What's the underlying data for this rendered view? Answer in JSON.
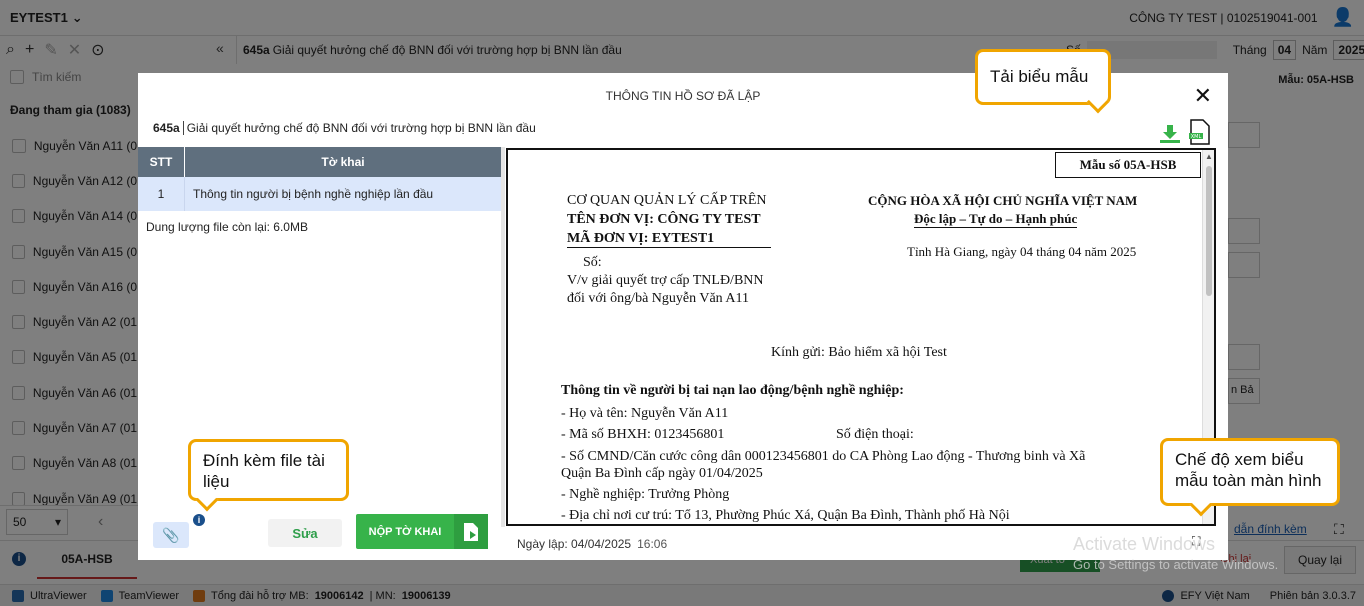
{
  "app": {
    "brand": "EYTEST1",
    "company": "CÔNG TY TEST | 0102519041-001",
    "record_title_code": "645a",
    "record_title": "Giải quyết hưởng chế độ BNN đối với trường hợp bị BNN lần đầu",
    "period": {
      "month_label": "Tháng",
      "month": "04",
      "year_label": "Năm",
      "year": "2025",
      "so_label": "Số"
    },
    "search_placeholder": "Tìm kiếm",
    "group_label": "Đang tham gia (1083)",
    "people": [
      "Nguyễn Văn A11 (0",
      "Nguyễn Văn A12 (0",
      "Nguyễn Văn A14 (0",
      "Nguyễn Văn A15 (0",
      "Nguyễn Văn A16 (0",
      "Nguyễn Văn A2 (01",
      "Nguyễn Văn A5 (01",
      "Nguyễn Văn A6 (01",
      "Nguyễn Văn A7 (01",
      "Nguyễn Văn A8 (01",
      "Nguyễn Văn A9 (01"
    ],
    "page_size": "50",
    "bottom_tab": "05A-HSB",
    "right_form": "Mẫu: 05A-HSB",
    "right_field_text": "n Bả",
    "attach_link": "dẫn đính kèm",
    "back_button": "Quay lại",
    "export_button": "Xuất tờ",
    "bottom_button2": "Ghi lại",
    "footer": {
      "ultraviewer": "UltraViewer",
      "teamviewer": "TeamViewer",
      "hotline_prefix": "Tổng đài hỗ trợ MB:",
      "hotline_mb": "19006142",
      "hotline_mn_prefix": "| MN:",
      "hotline_mn": "19006139",
      "vendor": "EFY Việt Nam",
      "version": "Phiên bản 3.0.3.7"
    }
  },
  "modal": {
    "title": "THÔNG TIN HỒ SƠ ĐÃ LẬP",
    "record_code": "645a",
    "record_title": "Giải quyết hưởng chế độ BNN đối với trường hợp bị BNN lần đầu",
    "table": {
      "headers": [
        "STT",
        "Tờ khai"
      ],
      "rows": [
        [
          "1",
          "Thông tin người bị bệnh nghề nghiệp lần đầu"
        ]
      ]
    },
    "quota": "Dung lượng file còn lại: 6.0MB",
    "edit_button": "Sửa",
    "submit_button": "NỘP TỜ KHAI",
    "created_label": "Ngày lập: 04/04/2025",
    "created_time": "16:06"
  },
  "document": {
    "form_no": "Mẫu số 05A-HSB",
    "agency_parent": "CƠ QUAN QUẢN LÝ CẤP TRÊN",
    "unit_name": "TÊN ĐƠN VỊ: CÔNG TY TEST",
    "unit_code": "MÃ ĐƠN VỊ: EYTEST1",
    "so": "Số:",
    "subject_1": "V/v giải quyết trợ cấp TNLĐ/BNN",
    "subject_2": "đối với  ông/bà Nguyễn Văn A11",
    "nation": "CỘNG HÒA XÃ HỘI CHỦ NGHĨA VIỆT NAM",
    "motto": "Độc lập – Tự do – Hạnh phúc",
    "place_date": "Tỉnh Hà Giang, ngày 04 tháng 04 năm 2025",
    "recipient": "Kính gửi: Bảo hiểm xã hội Test",
    "section_title": "Thông tin về người bị tai nạn lao động/bệnh nghề nghiệp:",
    "name": "- Họ và tên: Nguyễn Văn A11",
    "bhxh": "- Mã số BHXH: 0123456801",
    "phone": "Số điện thoại:",
    "id_line1": "- Số CMND/Căn cước công dân 000123456801 do CA Phòng Lao động - Thương binh và Xã",
    "id_line2": "Quận Ba Đình cấp ngày 01/04/2025",
    "job": "- Nghề nghiệp:  Trưởng Phòng",
    "address": "- Địa chỉ nơi cư trú: Tổ 13, Phường Phúc Xá, Quận Ba Đình, Thành phố Hà Nội"
  },
  "callouts": {
    "download": "Tải biểu mẫu",
    "attach": "Đính kèm file tài liệu",
    "fullscreen": "Chế độ xem biểu mẫu toàn màn hình"
  },
  "watermark": {
    "line1": "Activate Windows",
    "line2": "Go to Settings to activate Windows."
  },
  "colors": {
    "accent_green": "#37b34a",
    "table_header": "#5f6f7e",
    "selected_row": "#dbe7fb",
    "callout_border": "#f0a500"
  }
}
